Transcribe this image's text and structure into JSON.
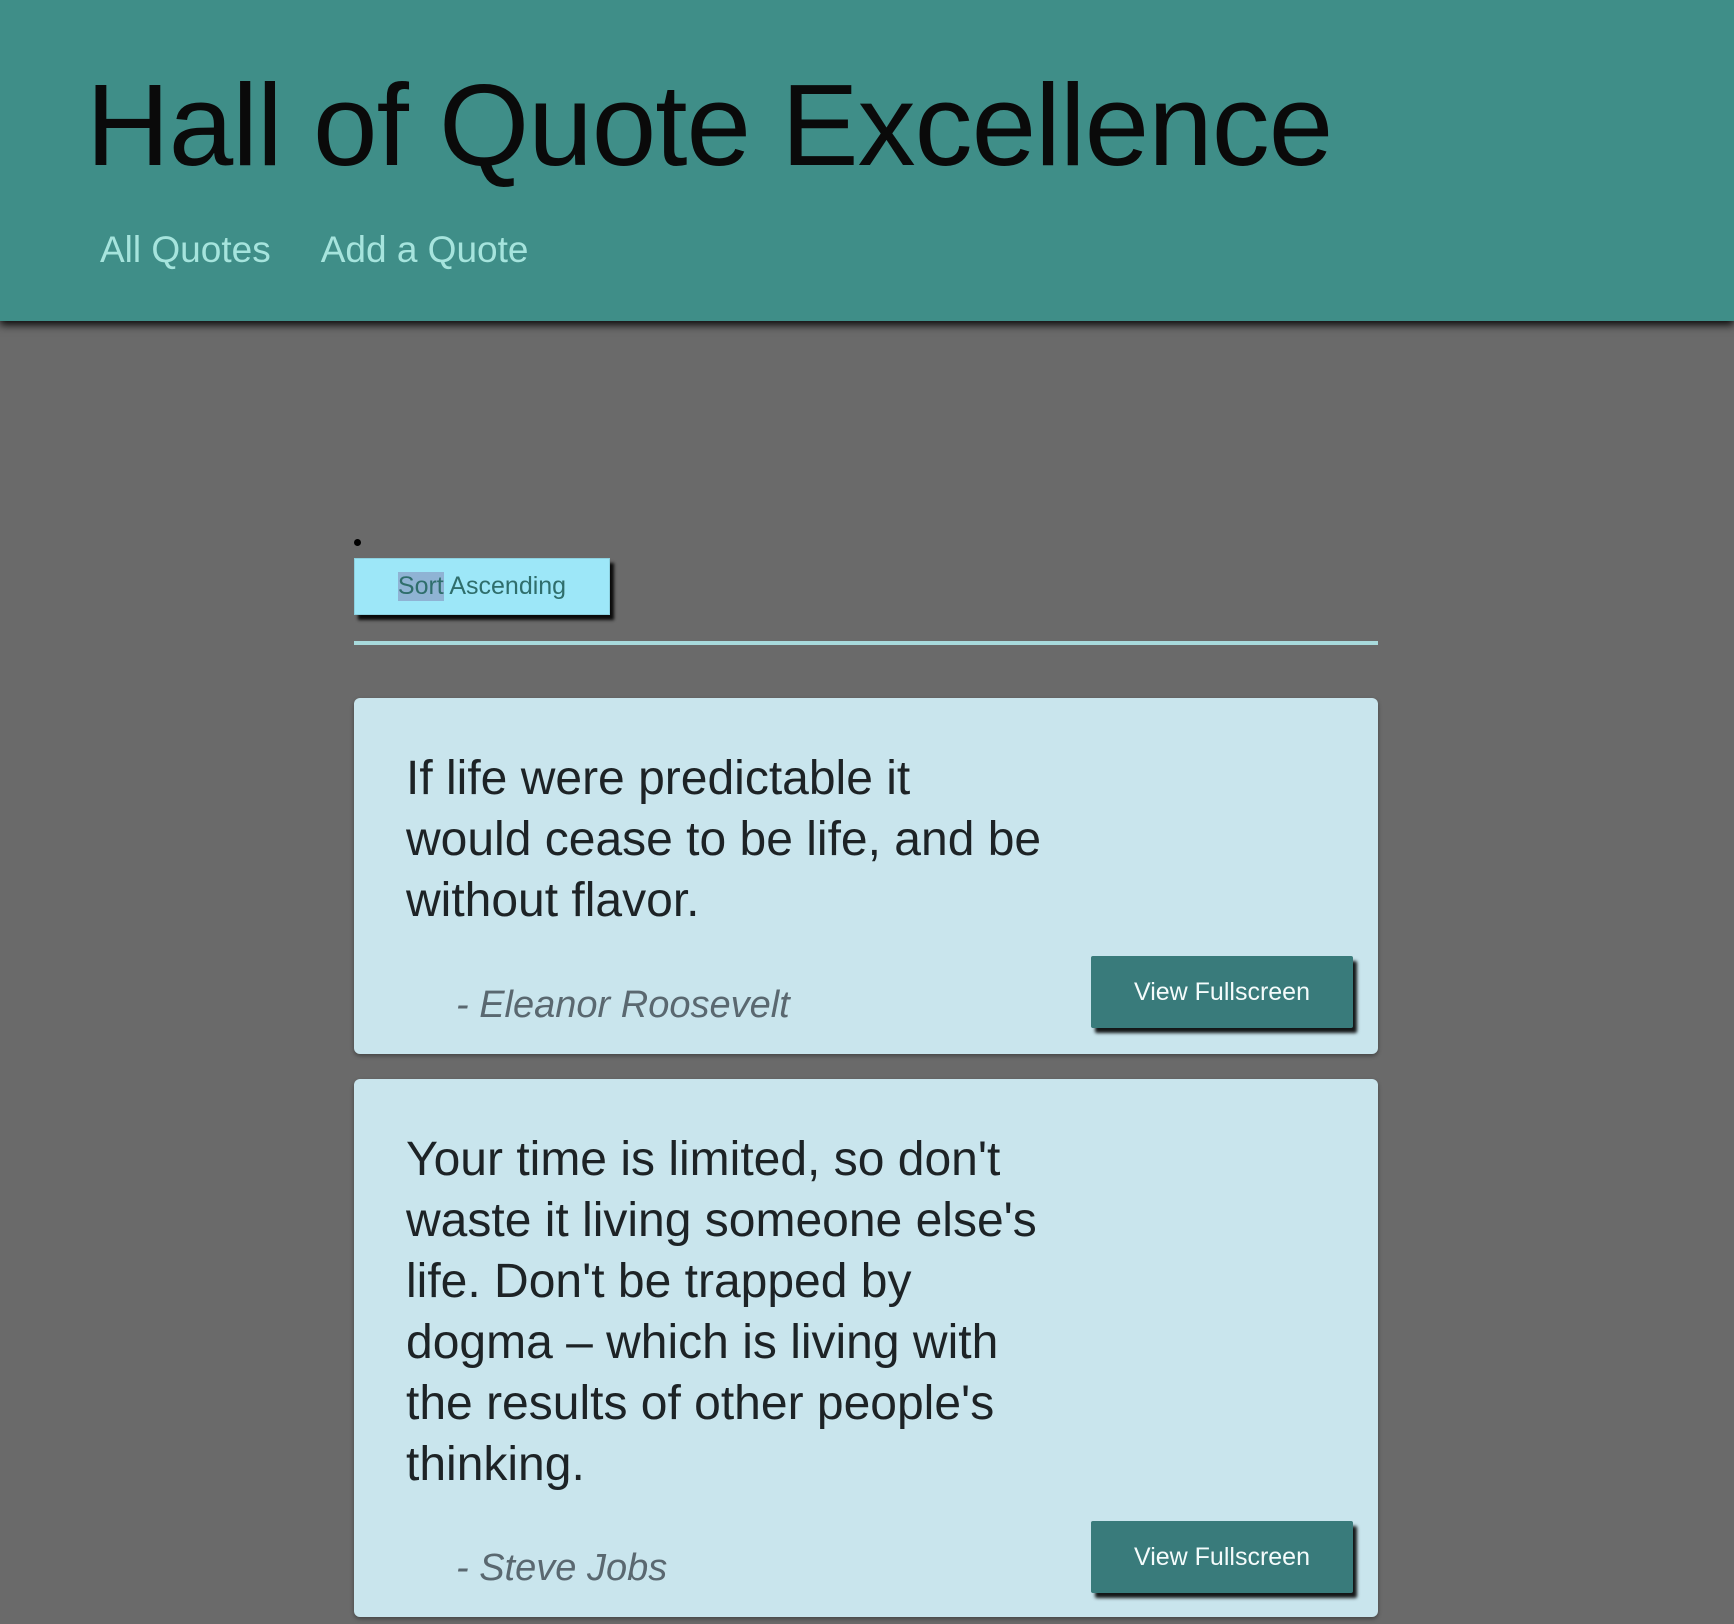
{
  "header": {
    "title": "Hall of Quote Excellence",
    "nav": [
      {
        "label": "All Quotes"
      },
      {
        "label": "Add a Quote"
      }
    ]
  },
  "sort": {
    "selected_part": "Sort",
    "rest": " Ascending"
  },
  "quotes": [
    {
      "text": "If life were predictable it would cease to be life, and be without flavor.",
      "author": "- Eleanor Roosevelt",
      "button_label": "View Fullscreen"
    },
    {
      "text": "Your time is limited, so don't waste it living someone else's life. Don't be trapped by dogma – which is living with the results of other people's thinking.",
      "author": "- Steve Jobs",
      "button_label": "View Fullscreen"
    }
  ],
  "colors": {
    "header_bg": "#3f8e88",
    "page_bg": "#6a6a6a",
    "nav_link": "#a6e4dd",
    "sort_button_bg": "#9de7f8",
    "card_bg": "#c9e5ed",
    "fullscreen_button_bg": "#397b7b"
  }
}
